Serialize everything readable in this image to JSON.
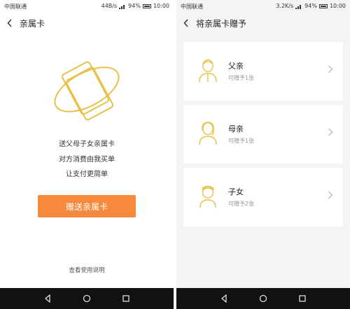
{
  "left": {
    "status": {
      "carrier": "中国联通",
      "speed": "44B/s",
      "battery": "94%",
      "time": "10:00"
    },
    "header": {
      "title": "亲属卡"
    },
    "intro_lines": [
      "送父母子女亲属卡",
      "对方消费由我买单",
      "让支付更简单"
    ],
    "gift_button": "赠送亲属卡",
    "help_link": "查看使用说明"
  },
  "right": {
    "status": {
      "carrier": "中国联通",
      "speed": "3.2K/s",
      "battery": "94%",
      "time": "10:00"
    },
    "header": {
      "title": "将亲属卡赠予"
    },
    "relatives": [
      {
        "name": "父亲",
        "quota": "可赠予1张",
        "icon": "father-avatar-icon"
      },
      {
        "name": "母亲",
        "quota": "可赠予1张",
        "icon": "mother-avatar-icon"
      },
      {
        "name": "子女",
        "quota": "可赠予2张",
        "icon": "child-avatar-icon"
      }
    ]
  },
  "colors": {
    "accent": "#f7893c",
    "icon_gold": "#e7c14a",
    "right_bg": "#f4f4f4",
    "navbar": "#111111"
  },
  "icons": [
    "back-arrow-icon",
    "card-illustration-icon",
    "chevron-right-icon",
    "nav-back-icon",
    "nav-home-icon",
    "nav-recents-icon"
  ]
}
